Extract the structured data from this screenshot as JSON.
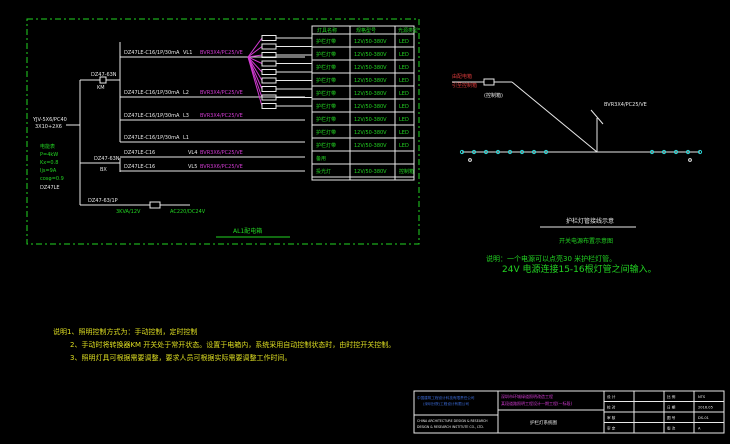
{
  "panel": {
    "incoming": [
      "YJV-5X6/PC40",
      "3X10+2X6"
    ],
    "meter": [
      "电能表",
      "P=4kW",
      "Kx=0.8"
    ],
    "breakers": {
      "main": "BX",
      "km": "KM",
      "branch": "DZ47LE"
    },
    "circuits": [
      {
        "id": "VL1",
        "breaker": "DZ47LE-C16/1P/30mA",
        "cable": "BVR3X4/PC25/VE",
        "lamp": "护栏灯带",
        "spec": "12V/50-380V",
        "type": "LED"
      },
      {
        "id": "L2",
        "breaker": "DZ47LE-C16/1P/30mA",
        "cable": "BVR3X4/PC25/VE",
        "lamp": "护栏灯带",
        "spec": "12V/50-380V",
        "type": "LED"
      },
      {
        "id": "L3",
        "breaker": "DZ47LE-C16/1P/30mA",
        "cable": "BVR3X4/PC25/VE",
        "lamp": "护栏灯带",
        "spec": "12V/50-380V",
        "type": "LED"
      },
      {
        "id": "L1",
        "breaker": "DZ47LE-C16/1P/30mA",
        "cable": "",
        "lamp": "",
        "spec": "",
        "type": ""
      },
      {
        "id": "VL4",
        "breaker": "DZ47LE-C16",
        "cable": "BVR3X6/PC25/VE",
        "lamp": "",
        "spec": "",
        "type": ""
      },
      {
        "id": "VL5",
        "breaker": "DZ47LE-C16",
        "cable": "BVR3X6/PC25/VE",
        "lamp": "",
        "spec": "",
        "type": ""
      }
    ],
    "table_headers": [
      "灯具名称",
      "规格型号",
      "光源类型"
    ],
    "table_rows": [
      [
        "护栏灯带",
        "12V/50-380V",
        "LED"
      ],
      [
        "护栏灯带",
        "12V/50-380V",
        "LED"
      ],
      [
        "护栏灯带",
        "12V/50-380V",
        "LED"
      ],
      [
        "护栏灯带",
        "12V/50-380V",
        "LED"
      ],
      [
        "护栏灯带",
        "12V/50-380V",
        "LED"
      ],
      [
        "护栏灯带",
        "12V/50-380V",
        "LED"
      ],
      [
        "护栏灯带",
        "12V/50-380V",
        "LED"
      ],
      [
        "护栏灯带",
        "12V/50-380V",
        "LED"
      ],
      [
        "护栏灯带",
        "12V/50-380V",
        "LED"
      ],
      [
        "备用",
        "",
        ""
      ],
      [
        "投光灯",
        "12V/50-380V",
        "控制箱"
      ]
    ],
    "transformer": [
      "3KVA/12V",
      "AC220/DC24V"
    ],
    "panel_title": "AL1配电箱"
  },
  "right": {
    "source": [
      "由配电箱",
      "引至控制箱"
    ],
    "source_box": "(控制箱)",
    "cable": "BVR3X4/PC25/VE",
    "box_title": "护栏灯管接线示意",
    "subtitle": "开关电源布置示意图",
    "note_line1": "说明：一个电源可以点亮30 米护栏灯管。",
    "note_line2": "24V 电源连接15-16根灯管之间输入。"
  },
  "notes": {
    "line1": "说明1、照明控制方式为：手动控制，定时控制",
    "line2": "2、手动时将转换器KM 开关处于常开状态。设置于电箱内，系统采用自动控制状态时，由时控开关控制。",
    "line3": "3、照明灯具可根据需要调整，要求人员可根据实际需要调整工作时间。"
  },
  "title_block": {
    "org_lines": [
      "中国建筑工程设计科技有限责任公司",
      "(深圳分院)工程设计有限公司",
      "CHINA ARCHITECTURE DESIGN & RESEARCH",
      "DESIGN & RESEARCH INSTITUTE CO., LTD."
    ],
    "project_lines": [
      "深圳市环城绿道照明改造工程",
      "某段道路照明工程设计一期工程(一标段)"
    ],
    "drawing_name": "护栏灯系统图",
    "fields": [
      "设 计",
      "校 对",
      "审 核",
      "审 定"
    ],
    "meta_labels": [
      "比 例",
      "日 期",
      "图 号",
      "版 次"
    ],
    "meta_values": [
      "NTS",
      "2016.05",
      "DS-01",
      "A"
    ]
  }
}
